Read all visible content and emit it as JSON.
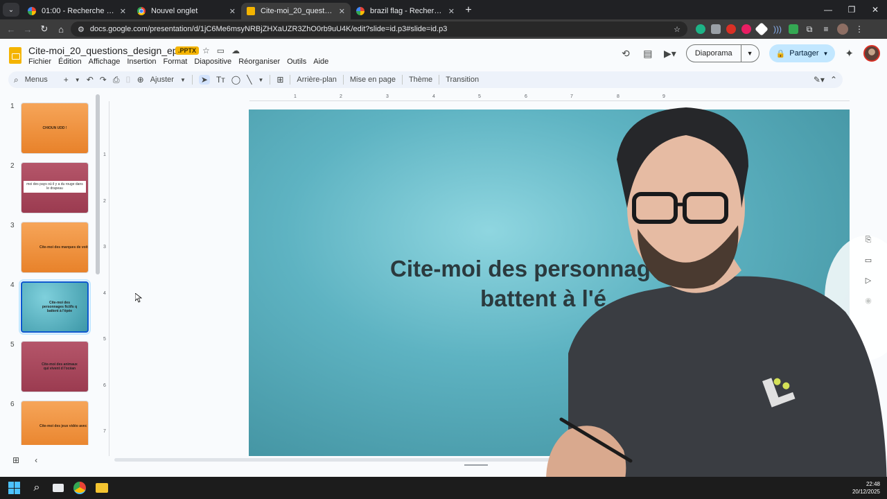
{
  "browser": {
    "tabs": [
      {
        "title": "01:00 - Recherche Google",
        "icon": "google-icon",
        "active": false
      },
      {
        "title": "Nouvel onglet",
        "icon": "chrome-icon",
        "active": false
      },
      {
        "title": "Cite-moi_20_questions_design_",
        "icon": "slides-icon",
        "active": true
      },
      {
        "title": "brazil flag - Recherche Google",
        "icon": "google-icon",
        "active": false
      }
    ],
    "url": "docs.google.com/presentation/d/1jC6Me6msyNRBjZHXaUZR3ZhO0rb9uU4K/edit?slide=id.p3#slide=id.p3"
  },
  "doc": {
    "title": "Cite-moi_20_questions_design_epure",
    "badge": ".PPTX"
  },
  "menu": [
    "Fichier",
    "Édition",
    "Affichage",
    "Insertion",
    "Format",
    "Diapositive",
    "Réorganiser",
    "Outils",
    "Aide"
  ],
  "header": {
    "slideshow_label": "Diaporama",
    "share_label": "Partager"
  },
  "toolbar": {
    "search_label": "Menus",
    "zoom_label": "Ajuster",
    "background_label": "Arrière-plan",
    "layout_label": "Mise en page",
    "theme_label": "Thème",
    "transition_label": "Transition"
  },
  "slides": [
    {
      "num": "1",
      "text": "CHIOUN UDD !",
      "color": "orange"
    },
    {
      "num": "2",
      "text": "moi des pays où il y a du rouge dans le drapeau",
      "color": "red"
    },
    {
      "num": "3",
      "text": "Cite-moi des marques de voitu",
      "color": "orange"
    },
    {
      "num": "4",
      "text": "Cite-moi des personnages fictifs q battent à l'épée",
      "color": "teal"
    },
    {
      "num": "5",
      "text": "Cite-moi des animaux qui vivent d l'océan",
      "color": "red"
    },
    {
      "num": "6",
      "text": "Cite-moi des jeux vidéo avec une t",
      "color": "orange"
    }
  ],
  "current_slide": {
    "line1": "Cite-moi des personnages fi",
    "line2": "battent à l'é"
  },
  "ruler": {
    "top": [
      "1",
      "2",
      "3",
      "4",
      "5",
      "6",
      "7",
      "8",
      "9"
    ],
    "left": [
      "1",
      "2",
      "3",
      "4",
      "5",
      "6",
      "7"
    ]
  },
  "clock": {
    "time": "22:48",
    "date": "20/12/2025"
  }
}
